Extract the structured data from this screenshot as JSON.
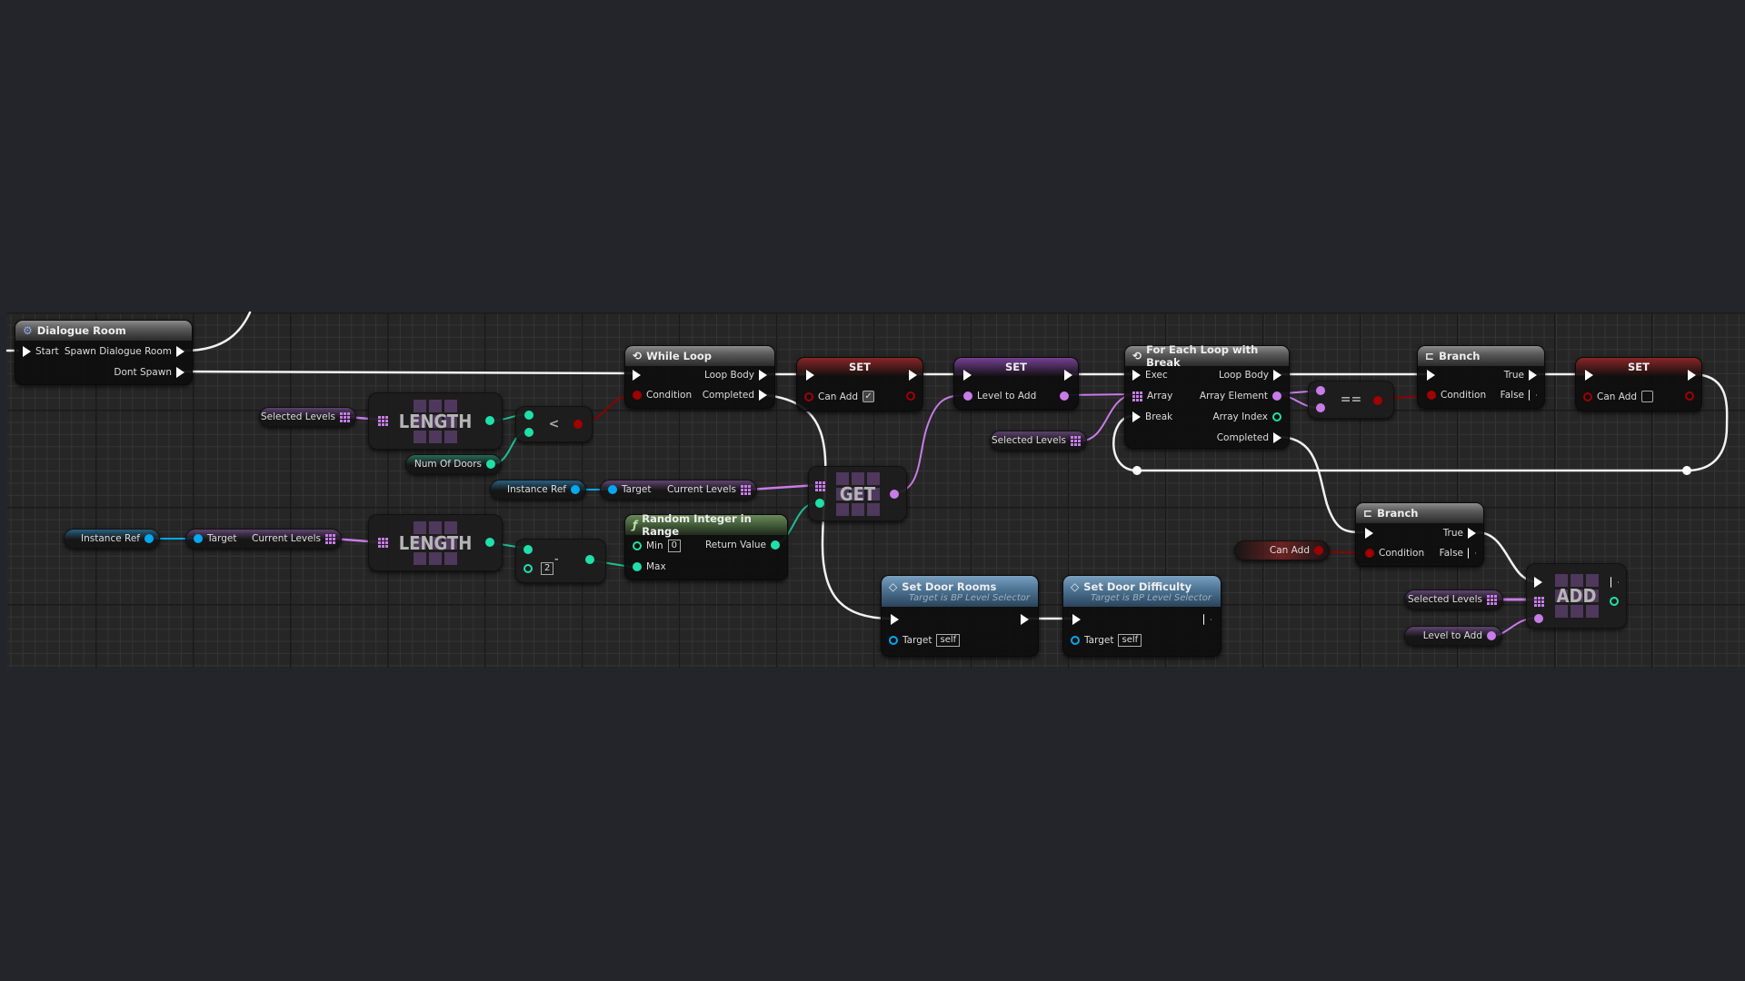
{
  "app": "Unreal Engine Blueprint Editor",
  "colors": {
    "exec": "#ffffff",
    "bool": "#8c0000",
    "int": "#1fe0a8",
    "object": "#00a8f0",
    "struct_array": "#c77ce8",
    "function_header": "#4c7392",
    "pure_function_header": "#46603c"
  },
  "nodes": {
    "dialogue_room": {
      "title": "Dialogue Room",
      "icon": "gear-icon",
      "in_exec": "Start",
      "out1": "Spawn Dialogue Room",
      "out2": "Dont Spawn"
    },
    "while_loop": {
      "title": "While Loop",
      "icon": "loop-icon",
      "condition": "Condition",
      "loop_body": "Loop Body",
      "completed": "Completed"
    },
    "set_can_add_true": {
      "title": "SET",
      "pin": "Can Add",
      "value": "✓"
    },
    "set_level_to_add": {
      "title": "SET",
      "pin": "Level to Add"
    },
    "for_each": {
      "title": "For Each Loop with Break",
      "icon": "loop-icon",
      "exec": "Exec",
      "array": "Array",
      "break": "Break",
      "loop_body": "Loop Body",
      "array_element": "Array Element",
      "array_index": "Array Index",
      "completed": "Completed"
    },
    "equals": {
      "op": "=="
    },
    "branch1": {
      "title": "Branch",
      "icon": "branch-icon",
      "condition": "Condition",
      "true": "True",
      "false": "False"
    },
    "set_can_add_false": {
      "title": "SET",
      "pin": "Can Add",
      "value": ""
    },
    "length1": {
      "label": "LENGTH"
    },
    "less_than": {
      "op": "<"
    },
    "length2": {
      "label": "LENGTH"
    },
    "subtract": {
      "op": "-",
      "value": "2"
    },
    "random_int": {
      "title": "Random Integer in Range",
      "icon": "function-icon",
      "min": "Min",
      "min_value": "0",
      "max": "Max",
      "return": "Return Value"
    },
    "get": {
      "label": "GET"
    },
    "set_door_rooms": {
      "title": "Set Door Rooms",
      "subtitle": "Target is BP Level Selector",
      "target": "Target",
      "target_value": "self"
    },
    "set_door_difficulty": {
      "title": "Set Door Difficulty",
      "subtitle": "Target is BP Level Selector",
      "target": "Target",
      "target_value": "self"
    },
    "branch2": {
      "title": "Branch",
      "icon": "branch-icon",
      "condition": "Condition",
      "true": "True",
      "false": "False"
    },
    "add": {
      "label": "ADD"
    }
  },
  "variables": {
    "selected_levels_1": "Selected Levels",
    "num_of_doors": "Num Of Doors",
    "instance_ref_2": "Instance Ref",
    "current_levels_2": {
      "target": "Target",
      "output": "Current Levels"
    },
    "selected_levels_2": "Selected Levels",
    "instance_ref_1": "Instance Ref",
    "current_levels_1": {
      "target": "Target",
      "output": "Current Levels"
    },
    "can_add": "Can Add",
    "selected_levels_3": "Selected Levels",
    "level_to_add": "Level to Add"
  }
}
